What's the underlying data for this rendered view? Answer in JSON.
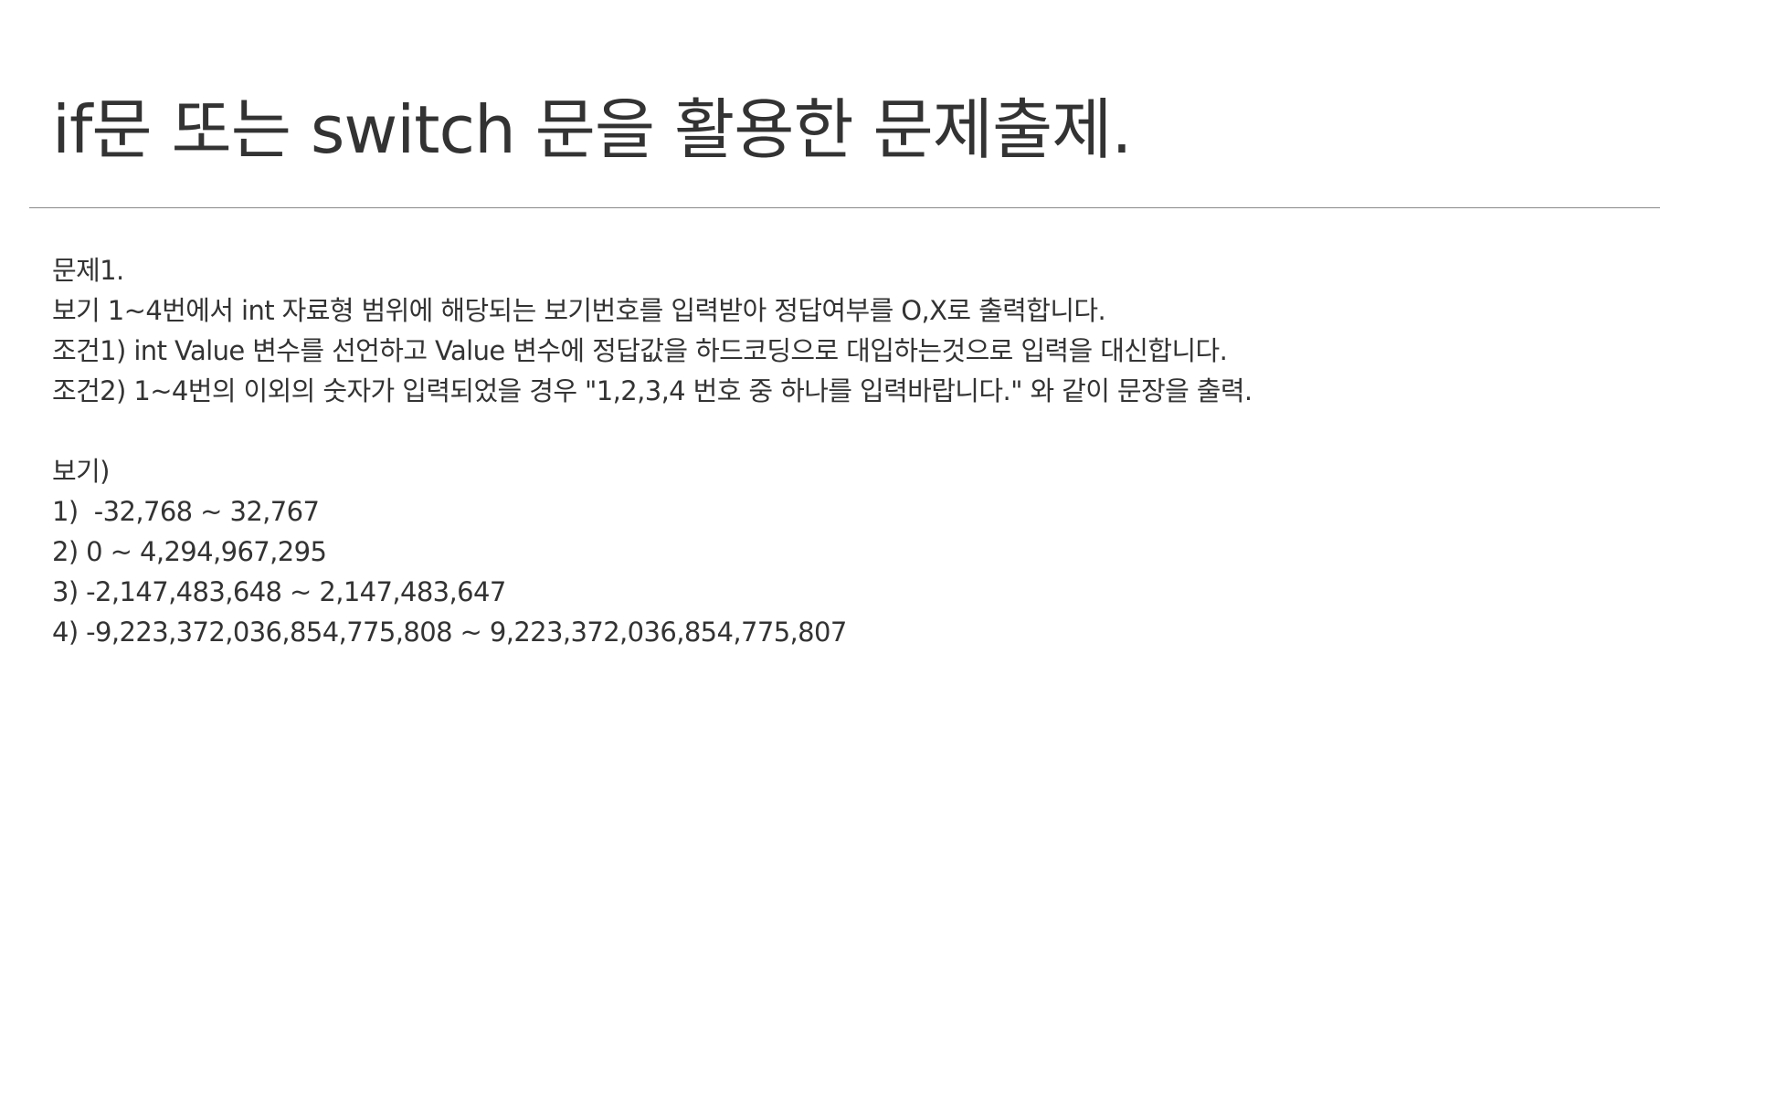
{
  "page": {
    "title": "if문 또는 switch 문을 활용한 문제출제."
  },
  "problem": {
    "heading": "문제1.",
    "description": "보기 1~4번에서 int 자료형 범위에 해당되는 보기번호를 입력받아 정답여부를 O,X로 출력합니다.",
    "conditions": [
      "조건1) int Value 변수를 선언하고 Value 변수에 정답값을 하드코딩으로 대입하는것으로 입력을 대신합니다.",
      "조건2) 1~4번의 이외의 숫자가 입력되었을 경우 \"1,2,3,4 번호 중 하나를 입력바랍니다.\" 와 같이 문장을 출력."
    ]
  },
  "choices": {
    "heading": "보기)",
    "items": [
      "1)  -32,768 ~ 32,767",
      "2) 0 ~ 4,294,967,295",
      "3) -2,147,483,648 ~ 2,147,483,647",
      "4) -9,223,372,036,854,775,808 ~ 9,223,372,036,854,775,807"
    ]
  }
}
